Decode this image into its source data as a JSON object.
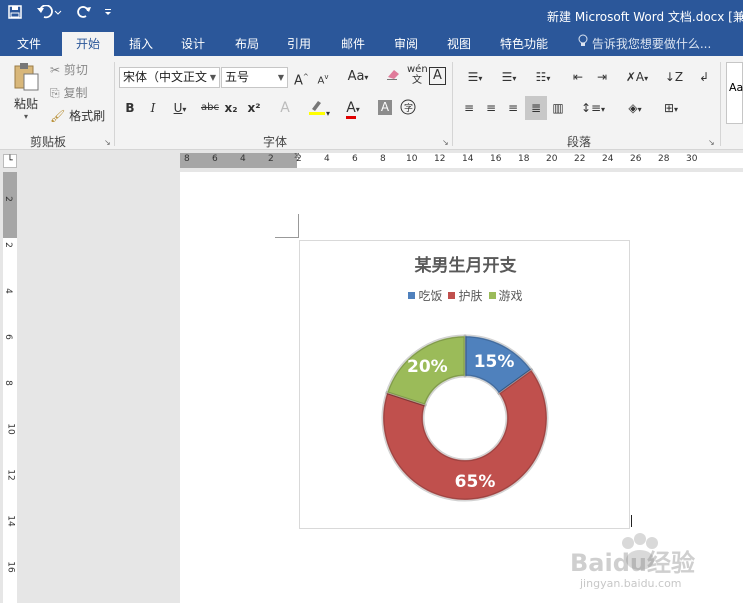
{
  "titlebar": {
    "save_icon": "save-icon",
    "undo_icon": "undo-icon",
    "redo_icon": "redo-icon",
    "customize_icon": "customize-qat-icon",
    "document_title": "新建 Microsoft Word 文档.docx [兼容"
  },
  "tabs": [
    "文件",
    "开始",
    "插入",
    "设计",
    "布局",
    "引用",
    "邮件",
    "审阅",
    "视图",
    "特色功能"
  ],
  "active_tab": "开始",
  "tell_me": "告诉我您想要做什么...",
  "clipboard": {
    "paste": "粘贴",
    "cut": "剪切",
    "copy": "复制",
    "format_painter": "格式刷",
    "label": "剪贴板"
  },
  "font": {
    "family": "宋体（中文正文",
    "size": "五号",
    "bold": "B",
    "italic": "I",
    "underline": "U",
    "strike": "abc",
    "subscript": "x₂",
    "superscript": "x²",
    "case": "Aa",
    "phonetic": "wén",
    "border_char": "A",
    "grow": "A",
    "shrink": "A",
    "label": "字体"
  },
  "paragraph": {
    "label": "段落"
  },
  "ruler": {
    "h_ticks": [
      "8",
      "6",
      "4",
      "2",
      "2",
      "4",
      "6",
      "8",
      "10",
      "12",
      "14",
      "16",
      "18",
      "20",
      "22",
      "24",
      "26",
      "28",
      "30"
    ],
    "v_ticks": [
      "2",
      "2",
      "4",
      "6",
      "8",
      "10",
      "12",
      "14",
      "16"
    ]
  },
  "chart_data": {
    "type": "pie",
    "style": "doughnut",
    "title": "某男生月开支",
    "categories": [
      "吃饭",
      "护肤",
      "游戏"
    ],
    "values": [
      15,
      65,
      20
    ],
    "labels": [
      "15%",
      "65%",
      "20%"
    ],
    "colors": [
      "#4f81bd",
      "#c0504d",
      "#9bbb59"
    ],
    "legend_position": "top"
  },
  "watermark": {
    "text_main": "Baidu经验",
    "text_sub": "jingyan.baidu.com"
  }
}
